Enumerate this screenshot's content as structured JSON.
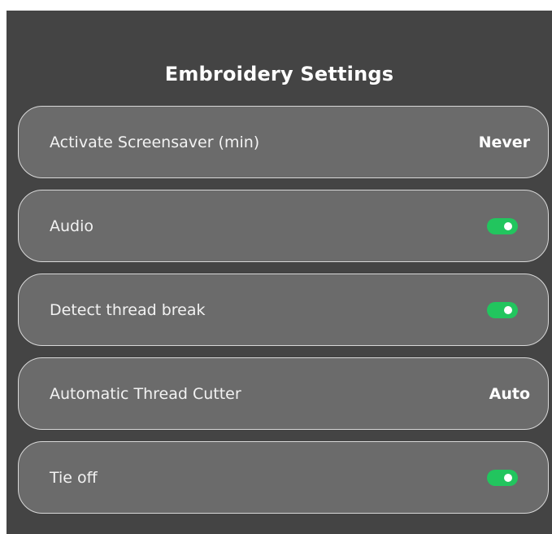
{
  "panel": {
    "title": "Embroidery Settings"
  },
  "colors": {
    "panel_background": "#444444",
    "row_background": "#6b6b6b",
    "toggle_on": "#22c55e"
  },
  "settings": [
    {
      "label": "Activate Screensaver (min)",
      "control": "value",
      "value": "Never"
    },
    {
      "label": "Audio",
      "control": "toggle",
      "on": true
    },
    {
      "label": "Detect thread break",
      "control": "toggle",
      "on": true
    },
    {
      "label": "Automatic Thread Cutter",
      "control": "value",
      "value": "Auto"
    },
    {
      "label": "Tie off",
      "control": "toggle",
      "on": true
    }
  ]
}
